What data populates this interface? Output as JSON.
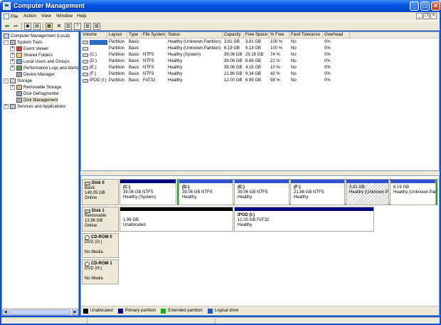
{
  "window": {
    "title": "Computer Management"
  },
  "menu": [
    "File",
    "Action",
    "View",
    "Window",
    "Help"
  ],
  "tree": {
    "items": [
      {
        "label": "Computer Management (Local)",
        "level": 0
      },
      {
        "label": "System Tools",
        "level": 1
      },
      {
        "label": "Event Viewer",
        "level": 2
      },
      {
        "label": "Shared Folders",
        "level": 2
      },
      {
        "label": "Local Users and Groups",
        "level": 2
      },
      {
        "label": "Performance Logs and Alerts",
        "level": 2
      },
      {
        "label": "Device Manager",
        "level": 2
      },
      {
        "label": "Storage",
        "level": 1
      },
      {
        "label": "Removable Storage",
        "level": 2
      },
      {
        "label": "Disk Defragmenter",
        "level": 2
      },
      {
        "label": "Disk Management",
        "level": 2
      },
      {
        "label": "Services and Applications",
        "level": 1
      }
    ]
  },
  "volume_list": {
    "columns": [
      "Volume",
      "Layout",
      "Type",
      "File System",
      "Status",
      "Capacity",
      "Free Space",
      "% Free",
      "Fault Tolerance",
      "Overhead"
    ],
    "rows": [
      [
        "",
        "Partition",
        "Basic",
        "",
        "Healthy (Unknown Partition)",
        "3.81 GB",
        "3.81 GB",
        "100 %",
        "No",
        "0%"
      ],
      [
        "",
        "Partition",
        "Basic",
        "",
        "Healthy (Unknown Partition)",
        "6.19 GB",
        "6.19 GB",
        "100 %",
        "No",
        "0%"
      ],
      [
        "(C:)",
        "Partition",
        "Basic",
        "NTFS",
        "Healthy (System)",
        "39.06 GB",
        "29.18 GB",
        "74 %",
        "No",
        "0%"
      ],
      [
        "(D:)",
        "Partition",
        "Basic",
        "NTFS",
        "Healthy",
        "39.06 GB",
        "8.66 GB",
        "22 %",
        "No",
        "0%"
      ],
      [
        "(E:)",
        "Partition",
        "Basic",
        "NTFS",
        "Healthy",
        "39.06 GB",
        "4.16 GB",
        "10 %",
        "No",
        "0%"
      ],
      [
        "(F:)",
        "Partition",
        "Basic",
        "NTFS",
        "Healthy",
        "21.86 GB",
        "9.34 GB",
        "42 %",
        "No",
        "0%"
      ],
      [
        "IPOD (I:)",
        "Partition",
        "Basic",
        "FAT32",
        "Healthy",
        "12.00 GB",
        "6.99 GB",
        "58 %",
        "No",
        "0%"
      ]
    ]
  },
  "disks": [
    {
      "name": "Disk 0",
      "lines": [
        "Basic",
        "149.05 GB",
        "Online"
      ],
      "partitions": [
        {
          "name": "(C:)",
          "size": "39.06 GB NTFS",
          "status": "Healthy (System)"
        },
        {
          "name": "(D:)",
          "size": "39.06 GB NTFS",
          "status": "Healthy"
        },
        {
          "name": "(E:)",
          "size": "39.06 GB NTFS",
          "status": "Healthy"
        },
        {
          "name": "(F:)",
          "size": "21.86 GB NTFS",
          "status": "Healthy"
        },
        {
          "name": "",
          "size": "3.81 GB",
          "status": "Healthy (Unknown Pa"
        },
        {
          "name": "",
          "size": "6.19 GB",
          "status": "Healthy (Unknown Par"
        }
      ]
    },
    {
      "name": "Disk 1",
      "lines": [
        "Removable",
        "13.96 GB",
        "Online"
      ],
      "partitions": [
        {
          "name": "",
          "size": "1.96 GB",
          "status": "Unallocated"
        },
        {
          "name": "IPOD (I:)",
          "size": "12.00 GB FAT32",
          "status": "Healthy"
        }
      ]
    },
    {
      "name": "CD-ROM 0",
      "lines": [
        "DVD (G:)",
        "",
        "No Media"
      ]
    },
    {
      "name": "CD-ROM 1",
      "lines": [
        "DVD (H:)",
        "",
        "No Media"
      ]
    }
  ],
  "legend": [
    {
      "label": "Unallocated",
      "color": "#000000"
    },
    {
      "label": "Primary partition",
      "color": "#000080"
    },
    {
      "label": "Extended partition",
      "color": "#22aa22"
    },
    {
      "label": "Logical drive",
      "color": "#2f52d0"
    }
  ]
}
